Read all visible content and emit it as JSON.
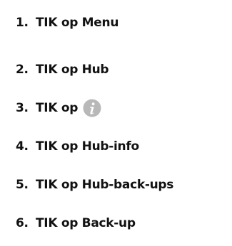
{
  "steps": [
    {
      "number": "1.",
      "text": "TIK op Menu"
    },
    {
      "number": "2.",
      "text": "TIK op Hub"
    },
    {
      "number": "3.",
      "text": "TIK op",
      "icon": "info-icon"
    },
    {
      "number": "4.",
      "text": "TIK op Hub-info"
    },
    {
      "number": "5.",
      "text": "TIK op Hub-back-ups"
    },
    {
      "number": "6.",
      "text": "TIK op Back-up"
    }
  ],
  "colors": {
    "text": "#111111",
    "icon_fill": "#b8b8b8",
    "icon_glyph": "#ffffff"
  }
}
